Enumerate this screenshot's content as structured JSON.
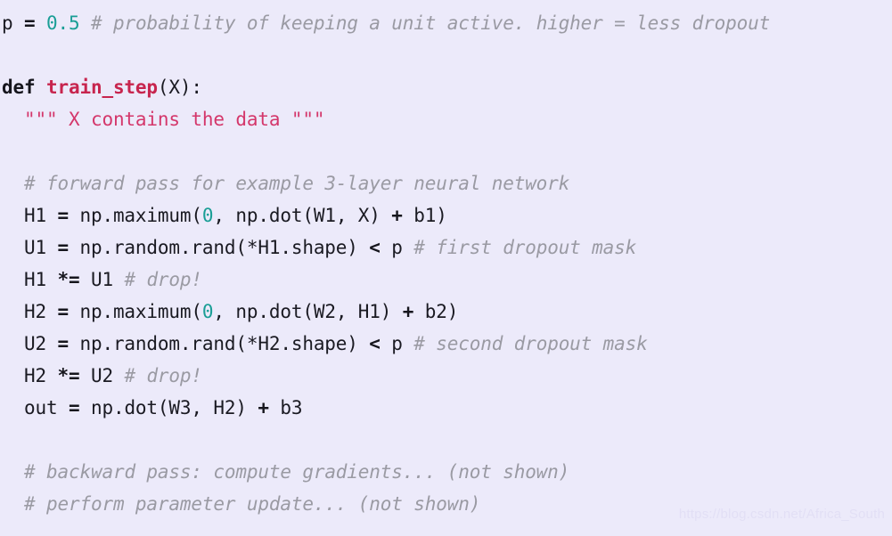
{
  "code": {
    "language": "python",
    "background_color": "#eceafa",
    "colors": {
      "plain": "#1a1a22",
      "keyword": "#16161d",
      "function_name": "#c7254e",
      "number": "#1a9e96",
      "string": "#d4376b",
      "comment": "#9a9aa3"
    },
    "lines": [
      {
        "id": "line-1",
        "tokens": [
          {
            "type": "plain",
            "text": "p "
          },
          {
            "type": "operator",
            "text": "="
          },
          {
            "type": "plain",
            "text": " "
          },
          {
            "type": "number",
            "text": "0.5"
          },
          {
            "type": "plain",
            "text": " "
          },
          {
            "type": "comment",
            "text": "# probability of keeping a unit active. higher = less dropout"
          }
        ]
      },
      {
        "id": "line-2",
        "tokens": []
      },
      {
        "id": "line-3",
        "tokens": [
          {
            "type": "keyword",
            "text": "def"
          },
          {
            "type": "plain",
            "text": " "
          },
          {
            "type": "funcname",
            "text": "train_step"
          },
          {
            "type": "plain",
            "text": "(X):"
          }
        ]
      },
      {
        "id": "line-4",
        "tokens": [
          {
            "type": "plain",
            "text": "  "
          },
          {
            "type": "string",
            "text": "\"\"\" X contains the data \"\"\""
          }
        ]
      },
      {
        "id": "line-5",
        "tokens": []
      },
      {
        "id": "line-6",
        "tokens": [
          {
            "type": "plain",
            "text": "  "
          },
          {
            "type": "comment",
            "text": "# forward pass for example 3-layer neural network"
          }
        ]
      },
      {
        "id": "line-7",
        "tokens": [
          {
            "type": "plain",
            "text": "  H1 "
          },
          {
            "type": "operator",
            "text": "="
          },
          {
            "type": "plain",
            "text": " np.maximum("
          },
          {
            "type": "number",
            "text": "0"
          },
          {
            "type": "plain",
            "text": ", np.dot(W1, X) "
          },
          {
            "type": "operator",
            "text": "+"
          },
          {
            "type": "plain",
            "text": " b1)"
          }
        ]
      },
      {
        "id": "line-8",
        "tokens": [
          {
            "type": "plain",
            "text": "  U1 "
          },
          {
            "type": "operator",
            "text": "="
          },
          {
            "type": "plain",
            "text": " np.random.rand(*H1.shape) "
          },
          {
            "type": "operator",
            "text": "<"
          },
          {
            "type": "plain",
            "text": " p "
          },
          {
            "type": "comment",
            "text": "# first dropout mask"
          }
        ]
      },
      {
        "id": "line-9",
        "tokens": [
          {
            "type": "plain",
            "text": "  H1 "
          },
          {
            "type": "operator",
            "text": "*="
          },
          {
            "type": "plain",
            "text": " U1 "
          },
          {
            "type": "comment",
            "text": "# drop!"
          }
        ]
      },
      {
        "id": "line-10",
        "tokens": [
          {
            "type": "plain",
            "text": "  H2 "
          },
          {
            "type": "operator",
            "text": "="
          },
          {
            "type": "plain",
            "text": " np.maximum("
          },
          {
            "type": "number",
            "text": "0"
          },
          {
            "type": "plain",
            "text": ", np.dot(W2, H1) "
          },
          {
            "type": "operator",
            "text": "+"
          },
          {
            "type": "plain",
            "text": " b2)"
          }
        ]
      },
      {
        "id": "line-11",
        "tokens": [
          {
            "type": "plain",
            "text": "  U2 "
          },
          {
            "type": "operator",
            "text": "="
          },
          {
            "type": "plain",
            "text": " np.random.rand(*H2.shape) "
          },
          {
            "type": "operator",
            "text": "<"
          },
          {
            "type": "plain",
            "text": " p "
          },
          {
            "type": "comment",
            "text": "# second dropout mask"
          }
        ]
      },
      {
        "id": "line-12",
        "tokens": [
          {
            "type": "plain",
            "text": "  H2 "
          },
          {
            "type": "operator",
            "text": "*="
          },
          {
            "type": "plain",
            "text": " U2 "
          },
          {
            "type": "comment",
            "text": "# drop!"
          }
        ]
      },
      {
        "id": "line-13",
        "tokens": [
          {
            "type": "plain",
            "text": "  out "
          },
          {
            "type": "operator",
            "text": "="
          },
          {
            "type": "plain",
            "text": " np.dot(W3, H2) "
          },
          {
            "type": "operator",
            "text": "+"
          },
          {
            "type": "plain",
            "text": " b3"
          }
        ]
      },
      {
        "id": "line-14",
        "tokens": []
      },
      {
        "id": "line-15",
        "tokens": [
          {
            "type": "plain",
            "text": "  "
          },
          {
            "type": "comment",
            "text": "# backward pass: compute gradients... (not shown)"
          }
        ]
      },
      {
        "id": "line-16",
        "tokens": [
          {
            "type": "plain",
            "text": "  "
          },
          {
            "type": "comment",
            "text": "# perform parameter update... (not shown)"
          }
        ]
      }
    ]
  },
  "watermark": {
    "text": "https://blog.csdn.net/Africa_South"
  }
}
